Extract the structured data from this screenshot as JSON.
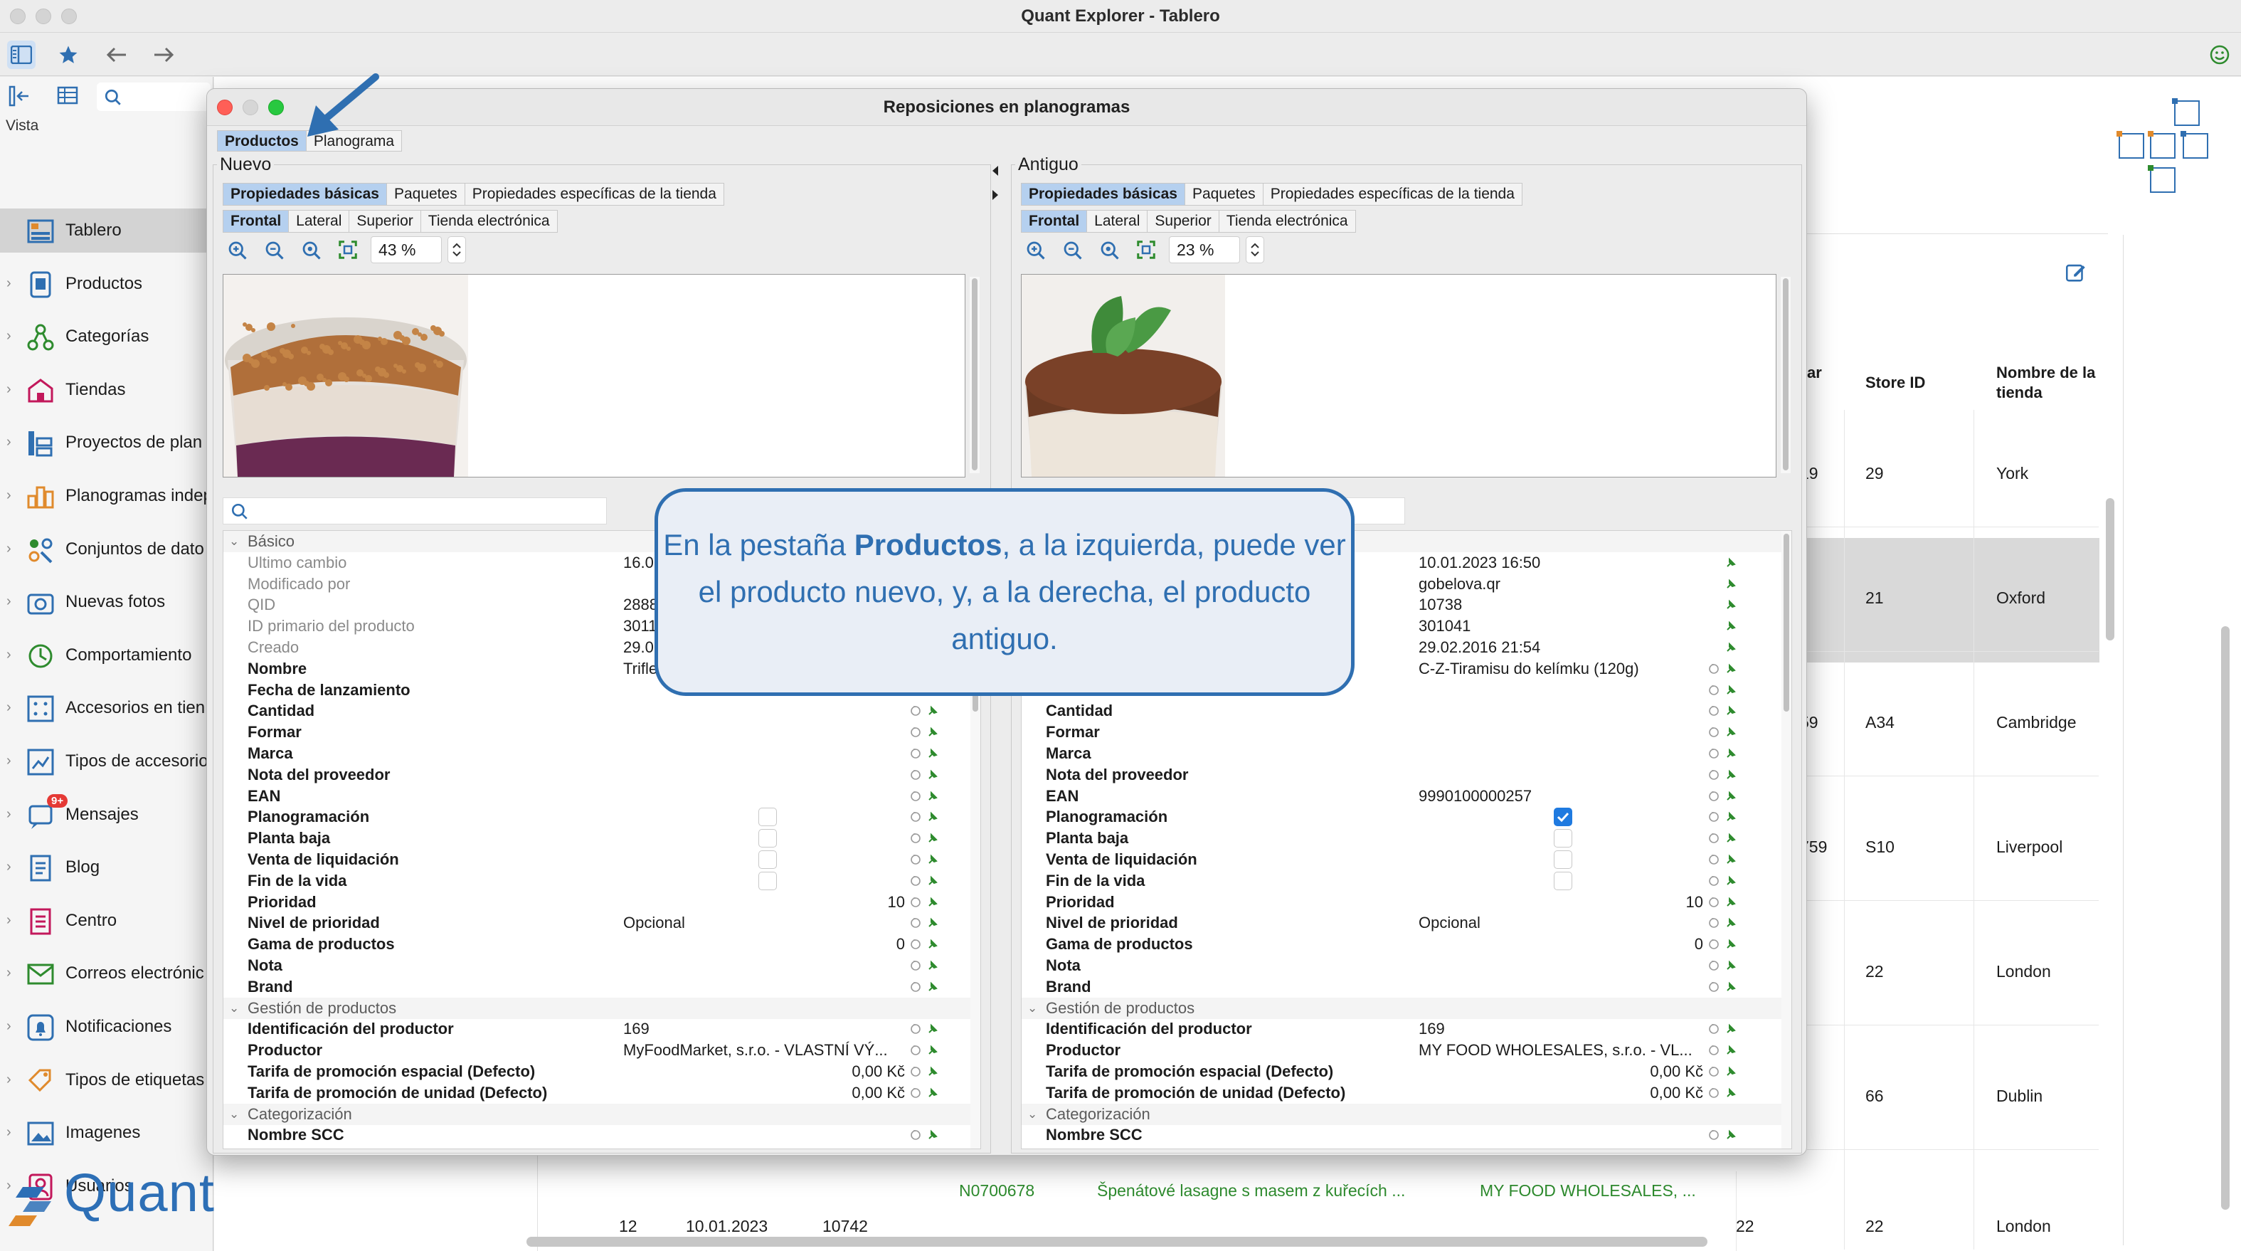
{
  "app": {
    "title": "Quant Explorer - Tablero",
    "logo_text": "Quant"
  },
  "sidebar": {
    "search_placeholder": "",
    "view_label": "Vista",
    "items": [
      {
        "label": "Tablero",
        "icon": "dashboard-icon",
        "active": true
      },
      {
        "label": "Productos",
        "icon": "products-icon"
      },
      {
        "label": "Categorías",
        "icon": "categories-icon"
      },
      {
        "label": "Tiendas",
        "icon": "stores-icon"
      },
      {
        "label": "Proyectos de plan",
        "icon": "planogram-projects-icon"
      },
      {
        "label": "Planogramas indep",
        "icon": "planograms-icon"
      },
      {
        "label": "Conjuntos de dato",
        "icon": "datasets-icon"
      },
      {
        "label": "Nuevas fotos",
        "icon": "camera-icon"
      },
      {
        "label": "Comportamiento",
        "icon": "behavior-icon"
      },
      {
        "label": "Accesorios en tien",
        "icon": "accessories-icon"
      },
      {
        "label": "Tipos de accesorio",
        "icon": "accessory-types-icon"
      },
      {
        "label": "Mensajes",
        "icon": "messages-icon",
        "badge": "9+"
      },
      {
        "label": "Blog",
        "icon": "blog-icon"
      },
      {
        "label": "Centro",
        "icon": "center-icon"
      },
      {
        "label": "Correos electrónic",
        "icon": "mail-icon"
      },
      {
        "label": "Notificaciones",
        "icon": "bell-icon"
      },
      {
        "label": "Tipos de etiquetas",
        "icon": "tag-types-icon"
      },
      {
        "label": "Imagenes",
        "icon": "images-icon"
      },
      {
        "label": "Usuarios",
        "icon": "users-icon"
      }
    ]
  },
  "background_table": {
    "headers": {
      "col_ar": "ar",
      "store_id": "Store ID",
      "store_name": "Nombre de la tienda"
    },
    "rows": [
      {
        "ar": "19",
        "store_id": "29",
        "store_name": "York"
      },
      {
        "ar": "",
        "store_id": "21",
        "store_name": "Oxford",
        "selected": true
      },
      {
        "ar": "59",
        "store_id": "A34",
        "store_name": "Cambridge"
      },
      {
        "ar": "759",
        "store_id": "S10",
        "store_name": "Liverpool"
      },
      {
        "ar": "",
        "store_id": "22",
        "store_name": "London"
      },
      {
        "ar": "",
        "store_id": "66",
        "store_name": "Dublin"
      }
    ],
    "bottom_row": {
      "c1": "12",
      "c2": "10.01.2023",
      "c3": "10742",
      "code": "N0700678",
      "name": "Špenátové lasagne s masem z kuřecích ...",
      "supplier": "MY FOOD WHOLESALES, ...",
      "c8": "22",
      "c9": "22",
      "c10": "London"
    }
  },
  "dialog": {
    "title": "Reposiciones en planogramas",
    "tabs": [
      "Productos",
      "Planograma"
    ],
    "selected_tab": "Productos",
    "sub_tabs": [
      "Propiedades básicas",
      "Paquetes",
      "Propiedades específicas de la tienda"
    ],
    "view_tabs": [
      "Frontal",
      "Lateral",
      "Superior",
      "Tienda electrónica"
    ],
    "groups": [
      "Básico",
      "Gestión de productos",
      "Categorización"
    ],
    "labels": {
      "ultimo_cambio": "Ultimo cambio",
      "modificado_por": "Modificado por",
      "qid": "QID",
      "id_primario": "ID primario del producto",
      "creado": "Creado",
      "nombre": "Nombre",
      "fecha_lanzamiento": "Fecha de lanzamiento",
      "cantidad": "Cantidad",
      "formar": "Formar",
      "marca": "Marca",
      "nota_proveedor": "Nota del proveedor",
      "ean": "EAN",
      "planogramacion": "Planogramación",
      "planta_baja": "Planta baja",
      "venta_liquidacion": "Venta de liquidación",
      "fin_vida": "Fin de la vida",
      "prioridad": "Prioridad",
      "nivel_prioridad": "Nivel de prioridad",
      "gama_productos": "Gama de productos",
      "nota": "Nota",
      "brand": "Brand",
      "id_productor": "Identificación del productor",
      "productor": "Productor",
      "tarifa_espacial": "Tarifa de promoción espacial (Defecto)",
      "tarifa_unidad": "Tarifa de promoción de unidad (Defecto)",
      "nombre_scc": "Nombre SCC"
    },
    "new": {
      "legend": "Nuevo",
      "zoom": "43 %",
      "image": "tiramisu-crumble-cup",
      "values": {
        "ultimo_cambio": "16.01",
        "qid": "2888",
        "id_primario": "3011",
        "creado": "29.02",
        "nombre": "Trifle",
        "prioridad": "10",
        "nivel_prioridad": "Opcional",
        "gama_productos": "0",
        "id_productor": "169",
        "productor": "MyFoodMarket, s.r.o. - VLASTNÍ VÝ...",
        "tarifa_espacial": "0,00 Kč",
        "tarifa_unidad": "0,00 Kč"
      },
      "planogramacion_checked": false
    },
    "old": {
      "legend": "Antiguo",
      "zoom": "23 %",
      "image": "tiramisu-mint-cup",
      "values": {
        "ultimo_cambio": "10.01.2023 16:50",
        "modificado_por": "gobelova.qr",
        "qid": "10738",
        "id_primario": "301041",
        "creado": "29.02.2016 21:54",
        "nombre": "C-Z-Tiramisu do kelímku (120g)",
        "ean": "9990100000257",
        "prioridad": "10",
        "nivel_prioridad": "Opcional",
        "gama_productos": "0",
        "id_productor": "169",
        "productor": "MY FOOD WHOLESALES, s.r.o. - VL...",
        "tarifa_espacial": "0,00 Kč",
        "tarifa_unidad": "0,00 Kč"
      },
      "planogramacion_checked": true
    }
  },
  "callout": {
    "text_before": "En la pestaña ",
    "text_bold": "Productos",
    "text_after": ", a la izquierda, puede ver el producto nuevo, y, a la derecha, el producto antiguo."
  },
  "colors": {
    "accent": "#2f6fb1",
    "selected_tab": "#b5d0ef",
    "checkbox_on": "#1f7ae0",
    "green_text": "#2e8b2e"
  }
}
